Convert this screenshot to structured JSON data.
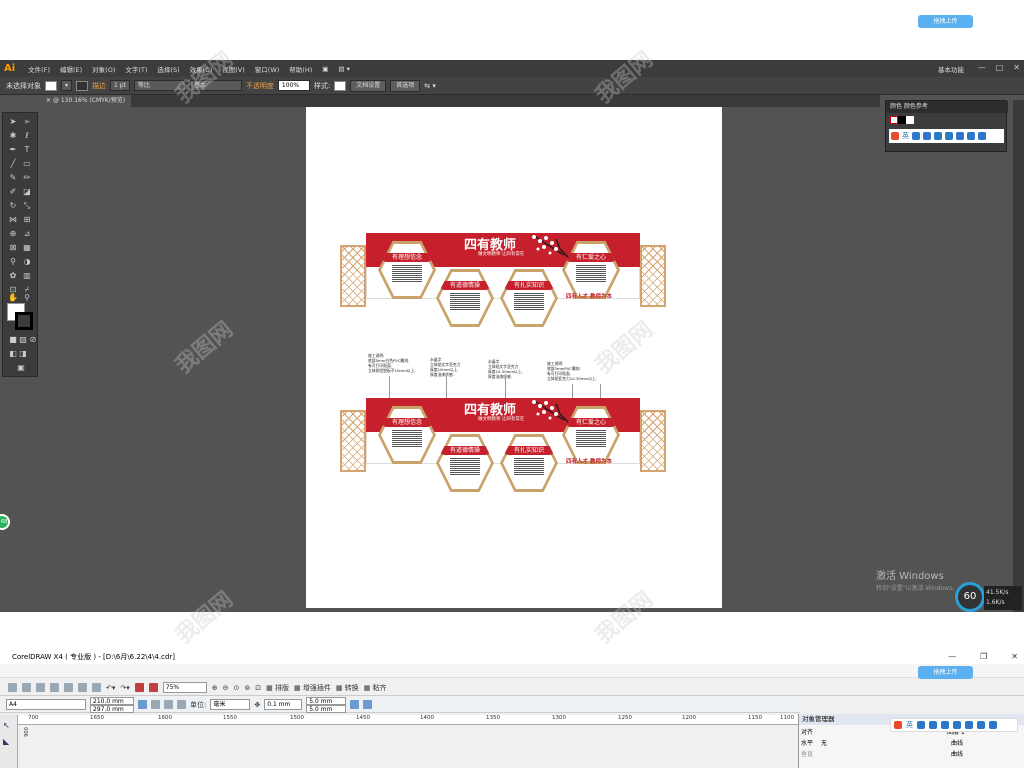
{
  "illustrator": {
    "logo": "Ai",
    "menu": [
      "文件(F)",
      "编辑(E)",
      "对象(O)",
      "文字(T)",
      "选择(S)",
      "效果(C)",
      "视图(V)",
      "窗口(W)",
      "帮助(H)"
    ],
    "workspace": "基本功能",
    "window_controls": [
      "—",
      "□",
      "✕"
    ],
    "control_bar": {
      "no_selection": "未选择对象",
      "stroke_label": "描边",
      "stroke_weight": "1 pt",
      "uniform": "等比",
      "basic": "基本",
      "opacity_label": "不透明度",
      "opacity_value": "100%",
      "style_label": "样式:",
      "doc_setup": "文档设置",
      "preferences": "首选项"
    },
    "document_tab": "@ 130.16% (CMYK/预览)",
    "panel": {
      "tabs": "颜色  颜色参考"
    },
    "upload_button": "拖拽上传",
    "windows_activation": "激活 Windows",
    "windows_activation_sub": "转到\"设置\"以激活 Windows。",
    "gauge_value": "60",
    "net_up": "41.5K/s",
    "net_down": "1.6K/s",
    "badge": "68"
  },
  "artwork": {
    "main_title": "四有教师",
    "subtitle": "做文明教师  让四有常在",
    "hex_titles": [
      "有理想信念",
      "有道德情操",
      "有扎实知识",
      "有仁爱之心"
    ],
    "motto": "四有人才 教师为本",
    "notes": [
      "施工说明:\n底部5mm白色PVC雕刻.\n有可打印贴面.\n立体贴铝塑板不10mm以上.",
      "水晶字\n立体贴文字亚克力\n厚度10mm以上.\n厚度油漆质感.",
      "水晶字\n立体贴文字亚克力\n厚度10-30mm以上.\n厚度油漆质感.",
      "施工说明:\n底部3mmPVC雕刻.\n有可打印贴面.\n立体贴亚克力10-30mm以上."
    ]
  },
  "coreldraw": {
    "title": "CorelDRAW X4 ( 专业版 ) - [D:\\6月\\6.22\\4\\4.cdr]",
    "window_controls": [
      "—",
      "❐",
      "✕"
    ],
    "std_toolbar": {
      "zoom": "75%",
      "arrange": "排版",
      "plugins": "增强插件",
      "convert": "转换",
      "paste": "粘齐"
    },
    "prop_bar": {
      "page_size": "A4",
      "width": "210.0 mm",
      "height": "297.0 mm",
      "unit_label": "单位:",
      "unit": "毫米",
      "nudge": "0.1 mm",
      "dup_x": "5.0 mm",
      "dup_y": "5.0 mm"
    },
    "ruler_labels": [
      "700",
      "1650",
      "1600",
      "1550",
      "1500",
      "1450",
      "1400",
      "1350",
      "1300",
      "1250",
      "1200",
      "1150",
      "1100"
    ],
    "vertical_ruler_label": "900",
    "object_manager": {
      "title": "对象管理器",
      "align_label": "对齐",
      "horizontal_label": "水平",
      "horizontal_value": "无",
      "vertical_label": "垂直",
      "layer": "图层 1",
      "items": [
        "曲线",
        "曲线"
      ]
    },
    "upload_button": "拖拽上传"
  },
  "watermark": "我图网",
  "colors": {
    "ai_bg": "#535353",
    "accent_red": "#c5202c",
    "gold": "#c9a36a",
    "upload_blue": "#5ab0f0"
  }
}
